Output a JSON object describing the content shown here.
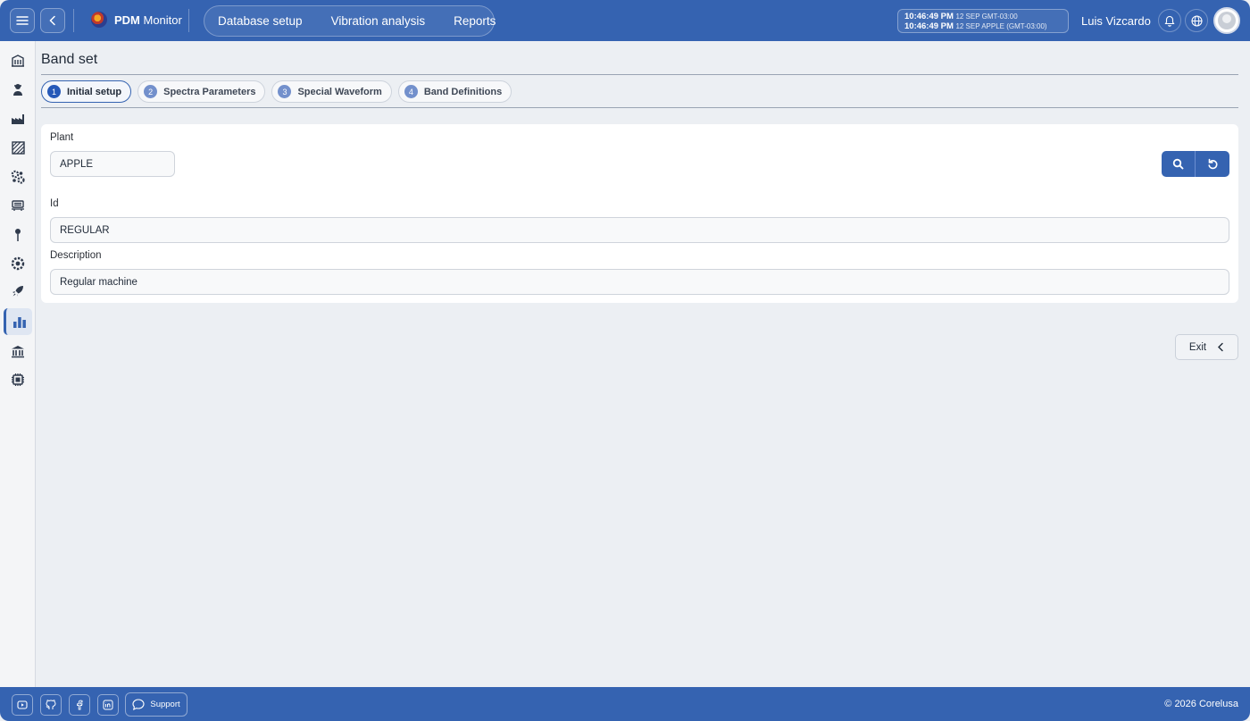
{
  "header": {
    "brand_bold": "PDM",
    "brand_rest": " Monitor",
    "nav": [
      "Database setup",
      "Vibration analysis",
      "Reports"
    ],
    "clock": {
      "line1_time": "10:46:49 PM",
      "line1_sub": "12 SEP  GMT-03:00",
      "line2_time": "10:46:49 PM",
      "line2_sub": "12 SEP  APPLE (GMT-03:00)"
    },
    "user_name": "Luis Vizcardo"
  },
  "sidebar": {
    "icons": [
      "building-icon",
      "operator-icon",
      "factory-icon",
      "area-icon",
      "gears-icon",
      "machine-icon",
      "point-icon",
      "component-icon",
      "rocket-icon",
      "chart-icon",
      "bank-icon",
      "chip-icon"
    ],
    "active_index": 9
  },
  "page": {
    "title": "Band set",
    "steps": [
      {
        "num": "1",
        "label": "Initial setup"
      },
      {
        "num": "2",
        "label": "Spectra Parameters"
      },
      {
        "num": "3",
        "label": "Special Waveform"
      },
      {
        "num": "4",
        "label": "Band Definitions"
      }
    ],
    "form": {
      "plant_label": "Plant",
      "plant_value": "APPLE",
      "id_label": "Id",
      "id_value": "REGULAR",
      "description_label": "Description",
      "description_value": "Regular machine"
    },
    "exit_label": "Exit"
  },
  "footer": {
    "support_label": "Support",
    "copyright": "© 2026 Corelusa"
  },
  "colors": {
    "primary": "#3563b1",
    "background": "#eceff3"
  }
}
